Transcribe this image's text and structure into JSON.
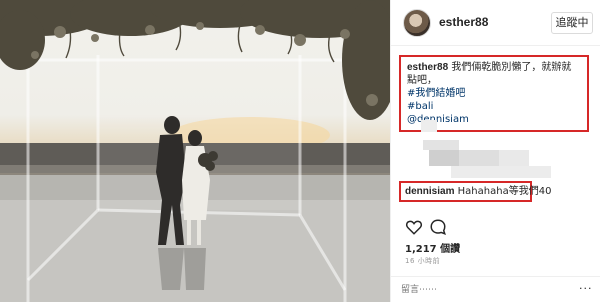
{
  "post": {
    "username": "esther88",
    "follow_label": "追蹤中",
    "caption": {
      "username": "esther88",
      "text": "我們倆乾脆別懶了，就辦就點吧，",
      "hashtag1": "#我們結婚吧",
      "hashtag2": "#bali",
      "mention": "@dennisiam"
    },
    "comment": {
      "username": "dennisiam",
      "text": "Hahahaha等我們40"
    },
    "likes": "1,217 個讚",
    "time_ago": "16 小時前",
    "comment_placeholder": "留言⋯⋯",
    "more_label": "···"
  },
  "colors": {
    "highlight_border": "#d62828",
    "link": "#003569"
  },
  "icons": [
    "heart-icon",
    "comment-icon",
    "more-options-icon"
  ]
}
